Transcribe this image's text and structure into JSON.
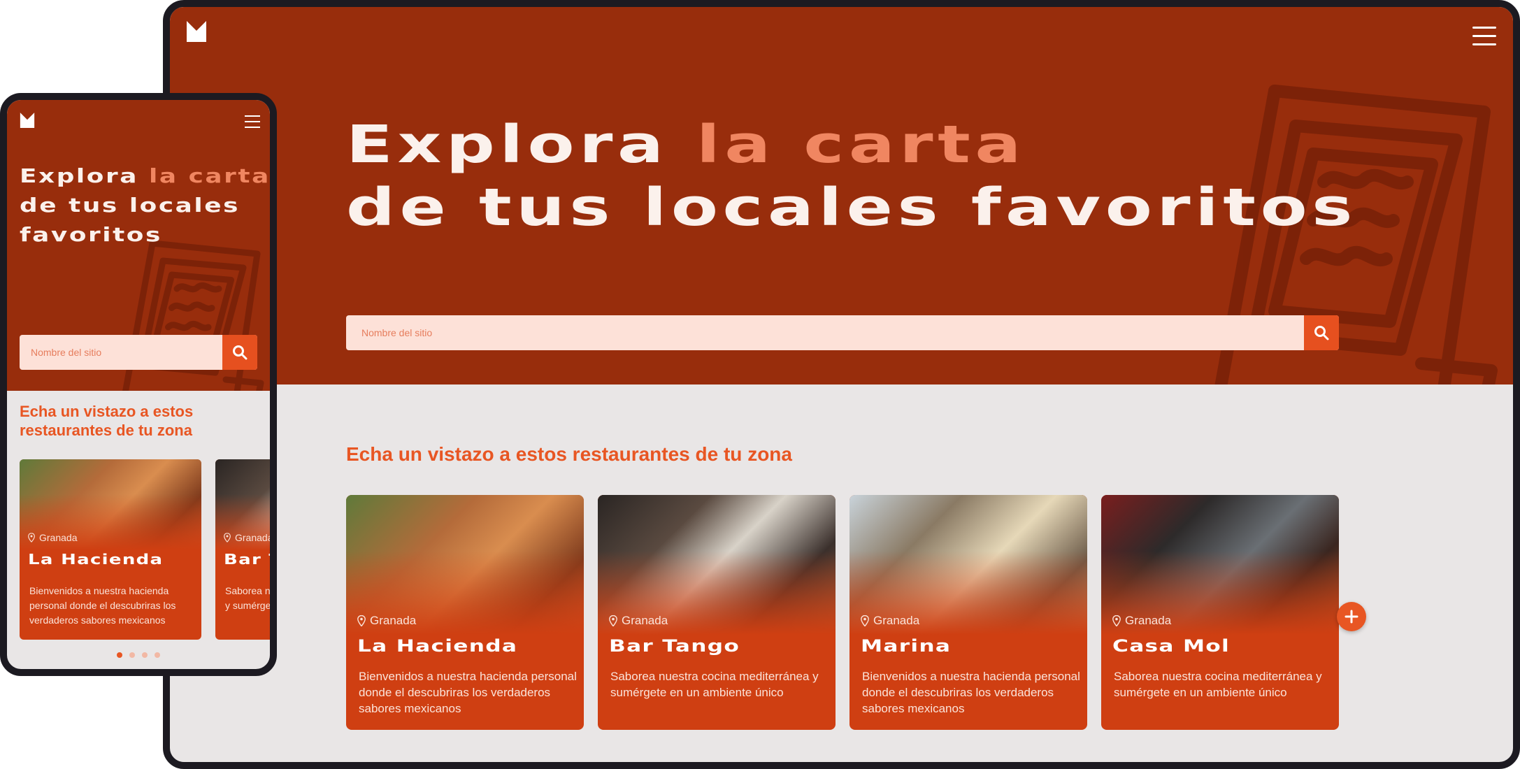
{
  "colors": {
    "hero_background": "#982d0c",
    "accent": "#f08661",
    "brand_orange": "#e85623",
    "card_background": "#cf3f12",
    "search_background": "#fde1d8",
    "page_background": "#e9e6e6"
  },
  "icons": {
    "logo": "m-logo-icon",
    "menu": "hamburger-menu-icon",
    "search": "search-icon",
    "location": "location-pin-icon",
    "add": "plus-icon"
  },
  "hero": {
    "title_part1": "Explora",
    "title_accent": "la carta",
    "title_line2": "de tus locales favoritos",
    "mobile_line2": "de tus locales",
    "mobile_line3": "favoritos"
  },
  "search": {
    "placeholder": "Nombre del sitio"
  },
  "section": {
    "title": "Echa un vistazo a estos restaurantes de tu zona"
  },
  "restaurants": [
    {
      "location": "Granada",
      "name": "La Hacienda",
      "description": "Bienvenidos a nuestra hacienda personal donde el descubriras los verdaderos sabores mexicanos"
    },
    {
      "location": "Granada",
      "name": "Bar Tango",
      "description": "Saborea nuestra cocina mediterránea y sumérgete en un ambiente único"
    },
    {
      "location": "Granada",
      "name": "Marina",
      "description": "Bienvenidos a nuestra hacienda personal donde el descubriras los verdaderos sabores mexicanos"
    },
    {
      "location": "Granada",
      "name": "Casa Mol",
      "description": "Saborea nuestra cocina mediterránea y sumérgete en un ambiente único"
    }
  ],
  "carousel": {
    "total_pages": 4,
    "active_page": 1
  }
}
